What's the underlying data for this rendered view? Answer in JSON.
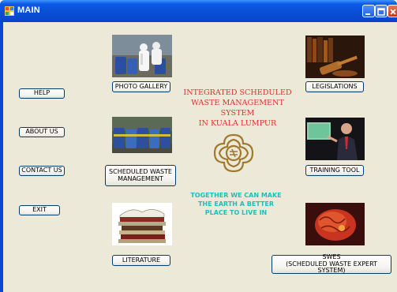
{
  "window": {
    "title": "MAIN",
    "controls": {
      "minimize_icon": "minimize-icon",
      "maximize_icon": "maximize-icon",
      "close_icon": "close-icon"
    }
  },
  "left_buttons": {
    "help": "HELP",
    "about": "ABOUT US",
    "contact": "CONTACT US",
    "exit": "EXIT"
  },
  "main_buttons": {
    "photo_gallery": "PHOTO GALLERY",
    "scheduled_waste_line1": "SCHEDULED WASTE",
    "scheduled_waste_line2": "MANAGEMENT",
    "literature": "LITERATURE",
    "legislations": "LEGISLATIONS",
    "training_tool": "TRAINING TOOL",
    "swes_line1": "SWES",
    "swes_line2": "(SCHEDULED WASTE EXPERT SYSTEM)"
  },
  "heading": {
    "line1": "INTEGRATED SCHEDULED",
    "line2": "WASTE MANAGEMENT SYSTEM",
    "line3": "IN KUALA LUMPUR"
  },
  "slogan": {
    "line1": "TOGETHER WE CAN MAKE",
    "line2": "THE EARTH A BETTER",
    "line3": "PLACE TO LIVE IN"
  },
  "colors": {
    "heading": "#e0302d",
    "slogan": "#1cc0b8",
    "emblem": "#a07a2c",
    "titlebar": "#0a4fd6",
    "background": "#ece9d8"
  }
}
